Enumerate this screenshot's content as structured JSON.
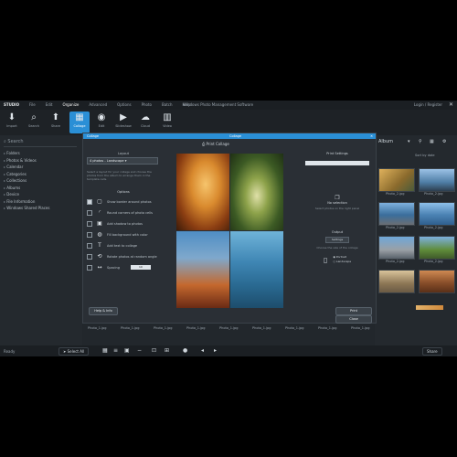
{
  "app": {
    "brand": "STUDIO",
    "menu": [
      "File",
      "Edit",
      "Organize",
      "Advanced",
      "Options",
      "Photo",
      "Batch",
      "Help"
    ],
    "active_menu_index": 2,
    "window_title": "Windows Photo Management Software",
    "account_label": "Login / Register",
    "accent": "#2a8fd6"
  },
  "toolbar": {
    "tools": [
      {
        "label": "Import",
        "icon": "import-icon",
        "glyph": "⬇"
      },
      {
        "label": "Search",
        "icon": "search-icon",
        "glyph": "⌕"
      },
      {
        "label": "Share",
        "icon": "share-icon",
        "glyph": "⬆"
      },
      {
        "label": "Collage",
        "icon": "collage-icon",
        "glyph": "▦"
      },
      {
        "label": "Edit",
        "icon": "edit-icon",
        "glyph": "◉"
      },
      {
        "label": "Slideshow",
        "icon": "play-icon",
        "glyph": "▶"
      },
      {
        "label": "Cloud",
        "icon": "cloud-icon",
        "glyph": "☁"
      },
      {
        "label": "Video",
        "icon": "video-icon",
        "glyph": "▥"
      }
    ],
    "active_index": 3
  },
  "left_panel": {
    "search_placeholder": "Search",
    "tree": [
      "Folders",
      "Photos & Videos",
      "Calendar",
      "Categories",
      "Collections",
      "Albums",
      "Device",
      "File Information",
      "Windows Shared Places"
    ]
  },
  "dialog": {
    "title": "Collage",
    "close_glyph": "✕",
    "header": "Print Collage",
    "layout_label": "Layout",
    "layout_value": "4 photos - Landscape",
    "description": "Select a layout for your collage and choose the photos from the album to arrange them in the template cells.",
    "options_title": "Options",
    "options": [
      {
        "label": "Show border around photos",
        "checked": true,
        "icon": "border-icon",
        "glyph": "▢"
      },
      {
        "label": "Round corners of photo cells",
        "checked": false,
        "icon": "corner-icon",
        "glyph": "◜"
      },
      {
        "label": "Add shadow to photos",
        "checked": false,
        "icon": "shadow-icon",
        "glyph": "▣"
      },
      {
        "label": "Fill background with color",
        "checked": false,
        "icon": "bucket-icon",
        "glyph": "◍"
      },
      {
        "label": "Add text to collage",
        "checked": false,
        "icon": "text-icon",
        "glyph": "T"
      },
      {
        "label": "Rotate photos at random angle",
        "checked": false,
        "icon": "rotate-icon",
        "glyph": "⟲"
      },
      {
        "label": "Spacing",
        "checked": false,
        "icon": "spacing-icon",
        "glyph": "↔"
      }
    ],
    "spacing_value": "10",
    "right_header": "Print Settings",
    "no_photo_title": "No selection",
    "no_photo_text": "Select photos on the right panel",
    "output_label": "Output",
    "output_button": "Settings",
    "output_hint": "Choose the size of the collage",
    "orientation_label": "Portrait",
    "orientation_alt": "Landscape",
    "help_button": "Help & Info",
    "ok_button": "Print",
    "cancel_button": "Close"
  },
  "right_panel": {
    "header": "Album",
    "sort_label": "Sort by date",
    "thumb_caption": "Photo_2.jpg"
  },
  "filmstrip": {
    "caption": "Photo_1.jpg"
  },
  "statusbar": {
    "left_text": "Ready",
    "select_button": "Select All",
    "right_button": "Share"
  }
}
